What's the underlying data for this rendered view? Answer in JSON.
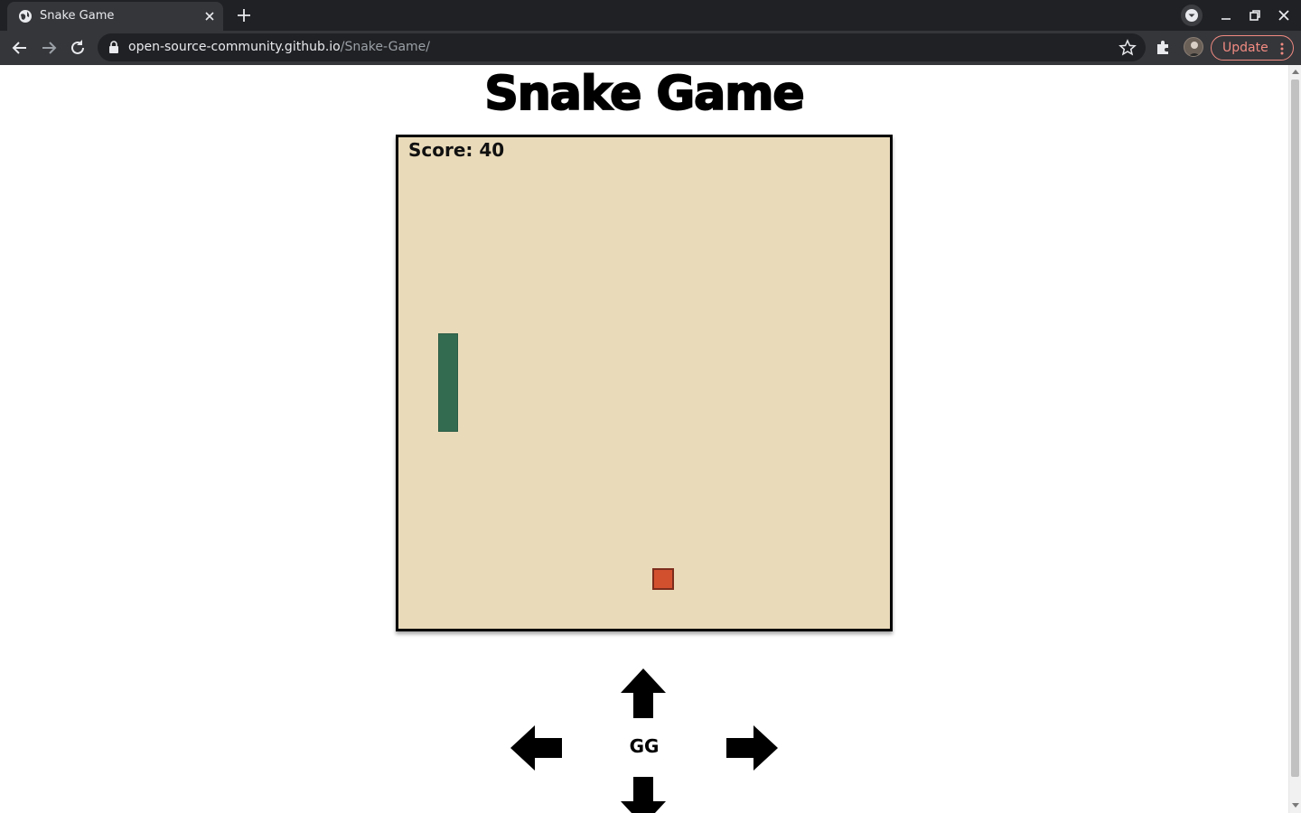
{
  "browser": {
    "tab_title": "Snake Game",
    "url_host": "open-source-community.github.io",
    "url_path": "/Snake-Game/",
    "update_label": "Update"
  },
  "page": {
    "title": "Snake Game",
    "score_text": "Score: 40",
    "center_label": "GG"
  },
  "game": {
    "snake": {
      "orientation": "vertical",
      "segments": 5
    },
    "food": {
      "present": true
    }
  },
  "colors": {
    "board_bg": "#e9dab9",
    "snake": "#336b51",
    "food": "#d3502f",
    "chrome_dark": "#202124",
    "chrome_tab": "#35363a",
    "update_accent": "#f28b82"
  },
  "icons": {
    "controls": [
      "arrow-up-icon",
      "arrow-left-icon",
      "arrow-right-icon",
      "arrow-down-icon"
    ]
  }
}
